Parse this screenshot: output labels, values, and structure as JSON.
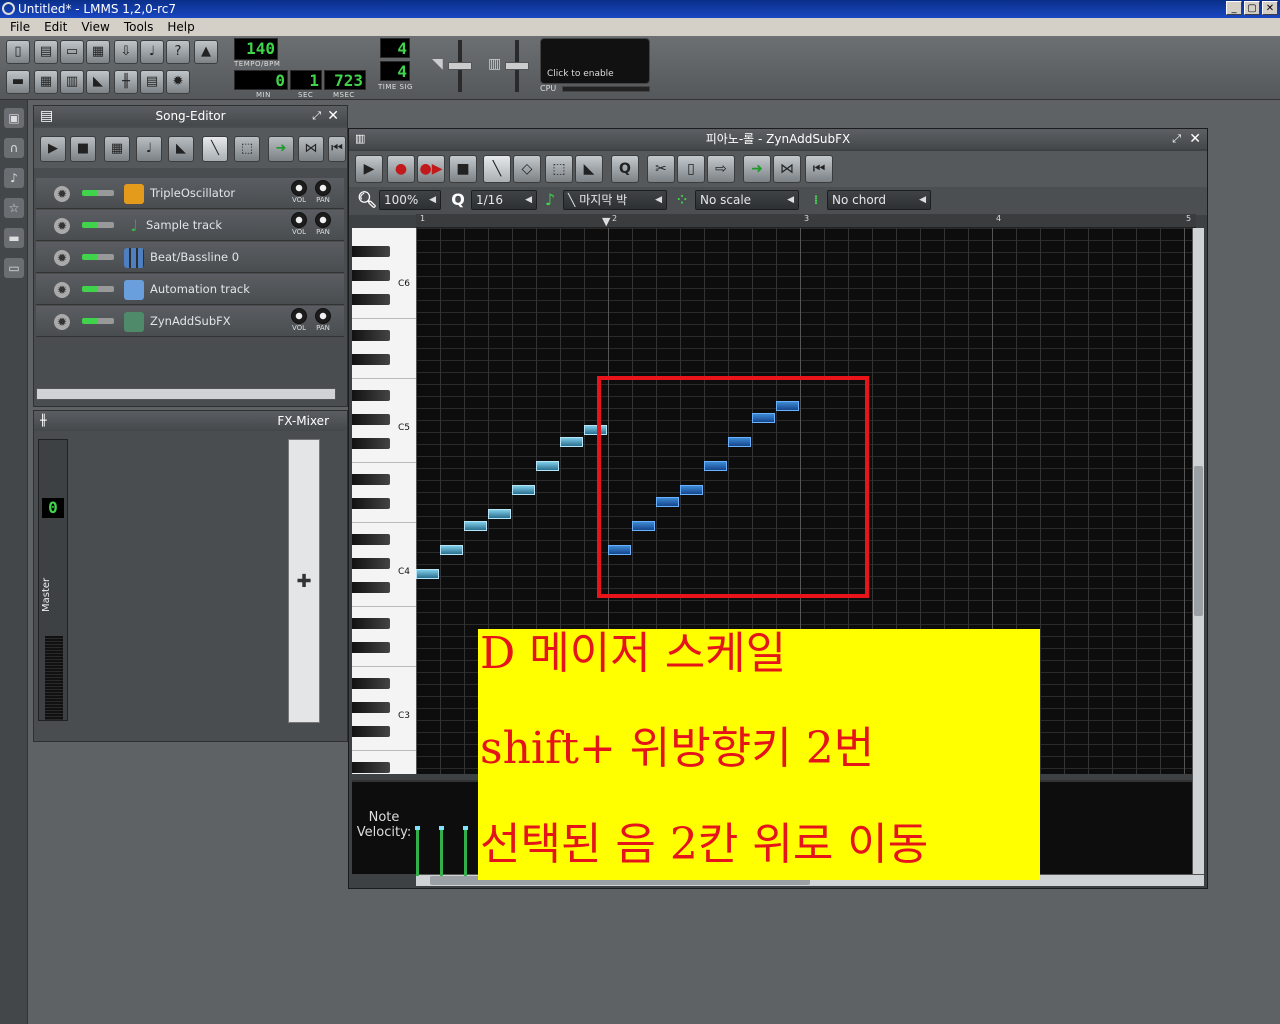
{
  "window": {
    "title": "Untitled* - LMMS 1,2,0-rc7",
    "controls": [
      "_",
      "▢",
      "✕"
    ]
  },
  "menu": [
    "File",
    "Edit",
    "View",
    "Tools",
    "Help"
  ],
  "toolbar": {
    "tempo_value": "140",
    "tempo_label": "TEMPO/BPM",
    "min_value": "0",
    "min_label": "MIN",
    "sec_value": "1",
    "sec_label": "SEC",
    "msec_value": "723",
    "msec_label": "MSEC",
    "timesig_num": "4",
    "timesig_den": "4",
    "timesig_label": "TIME SIG",
    "cpu_enable": "Click to enable",
    "cpu_label": "CPU"
  },
  "song_editor": {
    "title": "Song-Editor",
    "tracks": [
      {
        "name": "TripleOscillator",
        "has_knobs": true,
        "icon_color": "#e49b1c"
      },
      {
        "name": "Sample track",
        "has_knobs": true,
        "icon_color": "#3bb24a"
      },
      {
        "name": "Beat/Bassline 0",
        "has_knobs": false,
        "icon_color": "#4e7fc0"
      },
      {
        "name": "Automation track",
        "has_knobs": false,
        "icon_color": "#6a9fdd"
      },
      {
        "name": "ZynAddSubFX",
        "has_knobs": true,
        "icon_color": "#4f8a6a"
      }
    ],
    "knob_labels": {
      "vol": "VOL",
      "pan": "PAN"
    }
  },
  "fx_mixer": {
    "title": "FX-Mixer",
    "master_number": "0",
    "master_label": "Master",
    "add_symbol": "✚"
  },
  "piano_roll": {
    "title": "피아노-롤 - ZynAddSubFX",
    "zoom": "100%",
    "quantize": "1/16",
    "note_length": "마지막 박",
    "scale": "No scale",
    "chord": "No chord",
    "timeline_marks": [
      "1",
      "2",
      "3",
      "4",
      "5"
    ],
    "key_labels": [
      "C6",
      "C5",
      "C4",
      "C3"
    ],
    "velocity_label_line1": "Note",
    "velocity_label_line2": "Velocity:"
  },
  "caption": {
    "line1": "D 메이저 스케일",
    "line2": "shift+ 위방향키 2번",
    "line3": "선택된 음 2칸 위로 이동"
  },
  "colors": {
    "selection_rect": "#e8141a",
    "caption_bg": "#ffff00",
    "caption_text": "#e4141a",
    "lcd_green": "#3fd44b"
  }
}
